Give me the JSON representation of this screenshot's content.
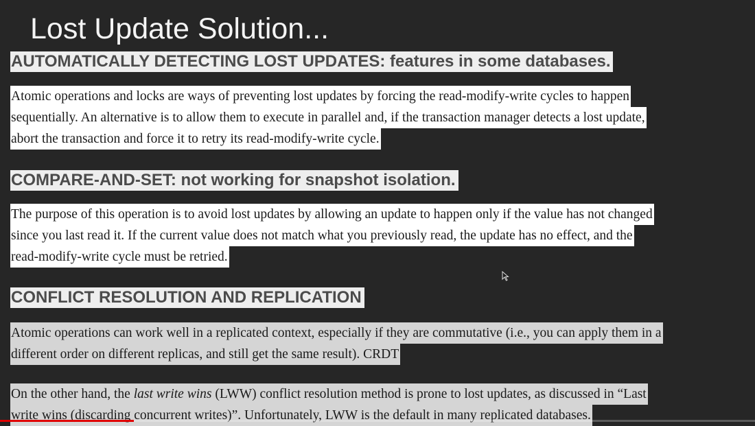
{
  "slide": {
    "title": "Lost Update Solution...",
    "section1": {
      "heading": "AUTOMATICALLY DETECTING LOST UPDATES: features in some databases.",
      "lines": [
        "Atomic operations and locks are ways of preventing lost updates by forcing the read-modify-write cycles to happen",
        "sequentially. An alternative is to allow them to execute in parallel and, if the transaction manager detects a lost update,",
        "abort the transaction and force it to retry its read-modify-write cycle."
      ]
    },
    "section2": {
      "heading": "COMPARE-AND-SET: not working for snapshot isolation.",
      "lines": [
        "The purpose of this operation is to avoid lost updates by allowing an update to happen only if the value has not changed",
        "since you last read it. If the current value does not match what you previously read, the update has no effect, and the",
        "read-modify-write cycle must be retried."
      ]
    },
    "section3": {
      "heading": "CONFLICT RESOLUTION AND REPLICATION",
      "para1": [
        "Atomic operations can work well in a replicated context, especially if they are commutative (i.e., you can apply them in a",
        "different order on different replicas, and still get the same result). CRDT"
      ],
      "para2": {
        "line1_before": "On the other hand, the ",
        "line1_emphasis": "last write wins",
        "line1_after": " (LWW) conflict resolution method is prone to lost updates, as discussed in “Last",
        "line2": "write wins (discarding concurrent writes)”. Unfortunately, LWW is the default in many replicated databases."
      }
    }
  },
  "player": {
    "progress_fraction": 0.177,
    "progress_color": "#e00000"
  }
}
